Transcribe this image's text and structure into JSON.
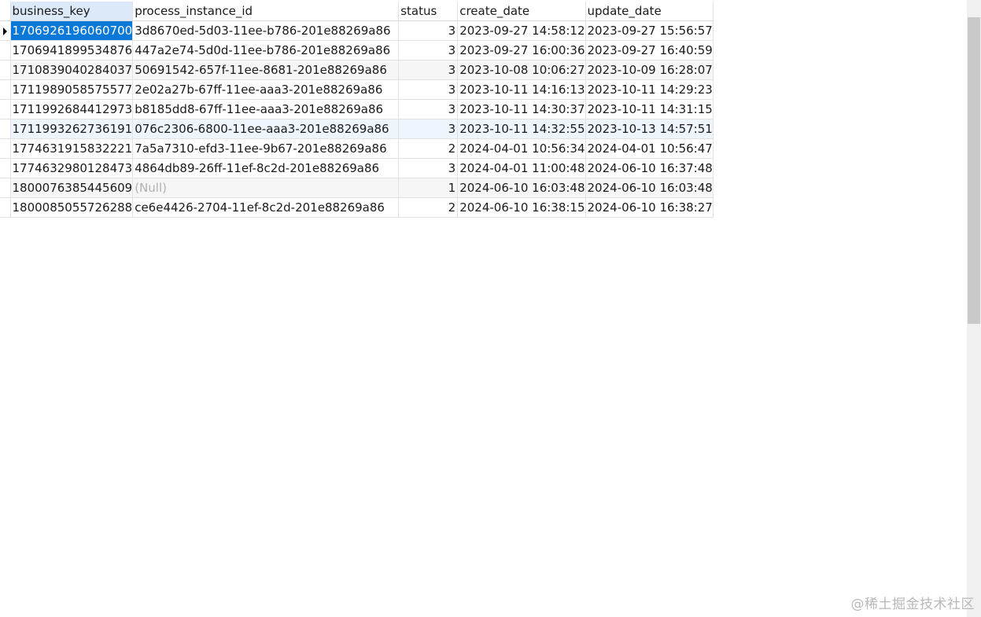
{
  "columns": [
    "business_key",
    "process_instance_id",
    "status",
    "create_date",
    "update_date"
  ],
  "rows": [
    {
      "business_key": "1706926196060700",
      "process_instance_id": "3d8670ed-5d03-11ee-b786-201e88269a86",
      "status": "3",
      "create_date": "2023-09-27 14:58:12",
      "update_date": "2023-09-27 15:56:57"
    },
    {
      "business_key": "1706941899534876",
      "process_instance_id": "447a2e74-5d0d-11ee-b786-201e88269a86",
      "status": "3",
      "create_date": "2023-09-27 16:00:36",
      "update_date": "2023-09-27 16:40:59"
    },
    {
      "business_key": "1710839040284037",
      "process_instance_id": "50691542-657f-11ee-8681-201e88269a86",
      "status": "3",
      "create_date": "2023-10-08 10:06:27",
      "update_date": "2023-10-09 16:28:07"
    },
    {
      "business_key": "1711989058575577",
      "process_instance_id": "2e02a27b-67ff-11ee-aaa3-201e88269a86",
      "status": "3",
      "create_date": "2023-10-11 14:16:13",
      "update_date": "2023-10-11 14:29:23"
    },
    {
      "business_key": "1711992684412973",
      "process_instance_id": "b8185dd8-67ff-11ee-aaa3-201e88269a86",
      "status": "3",
      "create_date": "2023-10-11 14:30:37",
      "update_date": "2023-10-11 14:31:15"
    },
    {
      "business_key": "1711993262736191",
      "process_instance_id": "076c2306-6800-11ee-aaa3-201e88269a86",
      "status": "3",
      "create_date": "2023-10-11 14:32:55",
      "update_date": "2023-10-13 14:57:51"
    },
    {
      "business_key": "1774631915832221",
      "process_instance_id": "7a5a7310-efd3-11ee-9b67-201e88269a86",
      "status": "2",
      "create_date": "2024-04-01 10:56:34",
      "update_date": "2024-04-01 10:56:47"
    },
    {
      "business_key": "1774632980128473",
      "process_instance_id": "4864db89-26ff-11ef-8c2d-201e88269a86",
      "status": "3",
      "create_date": "2024-04-01 11:00:48",
      "update_date": "2024-06-10 16:37:48"
    },
    {
      "business_key": "1800076385445609",
      "process_instance_id": "(Null)",
      "status": "1",
      "create_date": "2024-06-10 16:03:48",
      "update_date": "2024-06-10 16:03:48"
    },
    {
      "business_key": "1800085055726288",
      "process_instance_id": "ce6e4426-2704-11ef-8c2d-201e88269a86",
      "status": "2",
      "create_date": "2024-06-10 16:38:15",
      "update_date": "2024-06-10 16:38:27"
    }
  ],
  "watermark": "@稀土掘金技术社区"
}
